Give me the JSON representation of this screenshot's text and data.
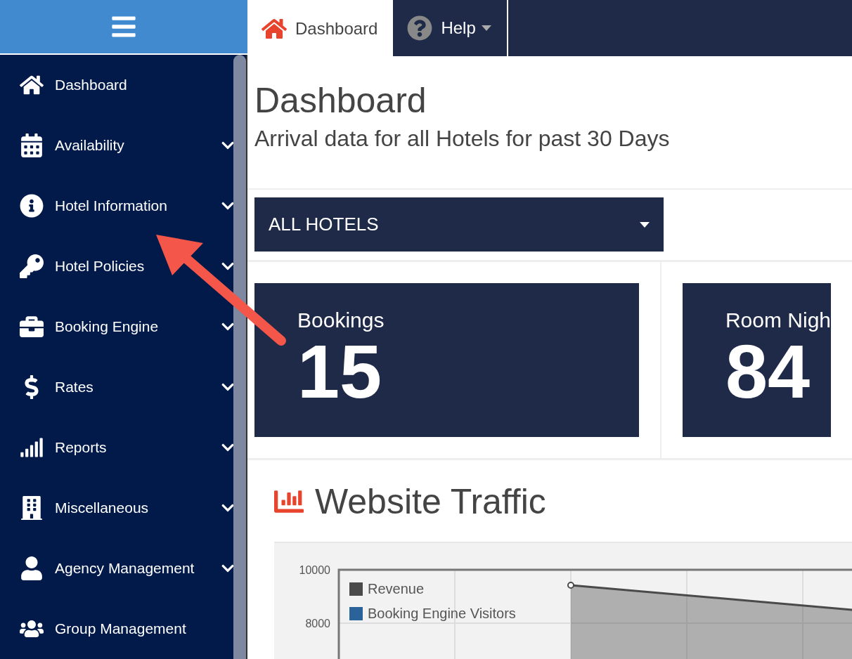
{
  "sidebar": {
    "items": [
      {
        "label": "Dashboard",
        "expandable": false
      },
      {
        "label": "Availability",
        "expandable": true
      },
      {
        "label": "Hotel Information",
        "expandable": true
      },
      {
        "label": "Hotel Policies",
        "expandable": true
      },
      {
        "label": "Booking Engine",
        "expandable": true
      },
      {
        "label": "Rates",
        "expandable": true
      },
      {
        "label": "Reports",
        "expandable": true
      },
      {
        "label": "Miscellaneous",
        "expandable": true
      },
      {
        "label": "Agency Management",
        "expandable": true
      },
      {
        "label": "Group Management",
        "expandable": false
      }
    ]
  },
  "tabs": [
    {
      "label": "Dashboard",
      "selected": true,
      "dropdown": false
    },
    {
      "label": "Help",
      "selected": false,
      "dropdown": true
    }
  ],
  "page": {
    "title": "Dashboard",
    "subtitle": "Arrival data for all Hotels for past 30 Days"
  },
  "hotel_select": {
    "value": "ALL HOTELS"
  },
  "stats": [
    {
      "label": "Bookings",
      "value": "15"
    },
    {
      "label": "Room Nigh",
      "value": "84"
    }
  ],
  "traffic": {
    "title": "Website Traffic",
    "y_labels": [
      "10000",
      "8000"
    ],
    "legend": [
      {
        "label": "Revenue",
        "color": "#4a4a4a"
      },
      {
        "label": "Booking Engine Visitors",
        "color": "#2a6399"
      }
    ]
  }
}
